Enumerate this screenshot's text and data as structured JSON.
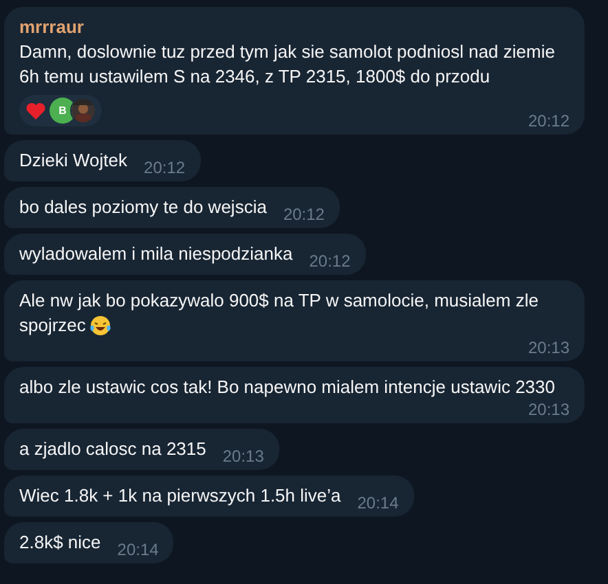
{
  "messages": [
    {
      "sender": "mrrraur",
      "text": "Damn, doslownie tuz przed tym jak sie samolot podniosl nad ziemie 6h temu ustawilem S na 2346, z TP 2315, 1800$ do przodu",
      "time": "20:12",
      "reactions": {
        "kind": "heart",
        "avatars": [
          {
            "kind": "initial",
            "initial": "B",
            "color": "#4caf50"
          },
          {
            "kind": "picture"
          }
        ]
      }
    },
    {
      "text": "Dzieki Wojtek",
      "time": "20:12"
    },
    {
      "text": "bo dales poziomy te do wejscia",
      "time": "20:12"
    },
    {
      "text": "wyladowalem i mila niespodzianka",
      "time": "20:12"
    },
    {
      "text": "Ale nw jak bo pokazywalo 900$ na TP w samolocie, musialem zle spojrzec",
      "trailing_emoji": true,
      "time": "20:13"
    },
    {
      "text": "albo zle ustawic cos tak! Bo napewno mialem intencje ustawic 2330",
      "time": "20:13"
    },
    {
      "text": "a zjadlo calosc na 2315",
      "time": "20:13"
    },
    {
      "text": "Wiec 1.8k + 1k na pierwszych 1.5h live’a",
      "time": "20:14"
    },
    {
      "text": "2.8k$ nice",
      "time": "20:14"
    }
  ]
}
